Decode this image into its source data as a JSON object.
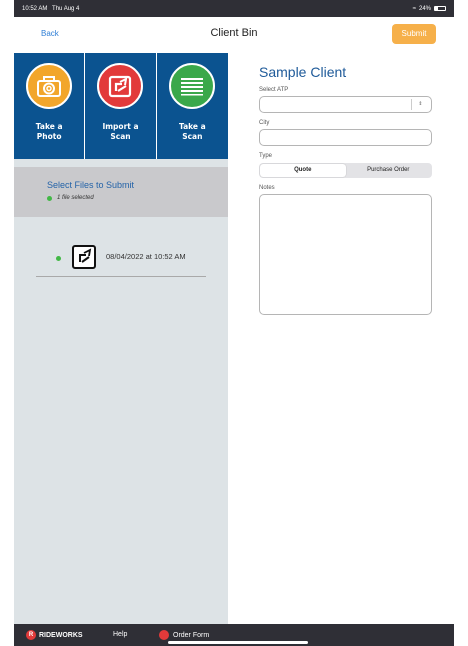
{
  "status": {
    "time": "10:52 AM",
    "date": "Thu Aug 4",
    "battery": "24%"
  },
  "nav": {
    "back_label": "Back",
    "title": "Client Bin",
    "submit_label": "Submit"
  },
  "tiles": [
    {
      "label": "Take a\nPhoto",
      "icon": "camera-icon",
      "color": "#f2a62b"
    },
    {
      "label": "Import a\nScan",
      "icon": "import-scan-icon",
      "color": "#e23a3a"
    },
    {
      "label": "Take a\nScan",
      "icon": "scan-lines-icon",
      "color": "#3aa84a"
    }
  ],
  "selection": {
    "title": "Select Files to Submit",
    "count_text": "1 file selected"
  },
  "files": [
    {
      "timestamp": "08/04/2022 at 10:52 AM",
      "icon": "import-scan-icon"
    }
  ],
  "client": {
    "name": "Sample Client",
    "select_atp_label": "Select ATP",
    "select_atp_value": "",
    "city_label": "City",
    "city_value": "",
    "type_label": "Type",
    "type_options": [
      "Quote",
      "Purchase Order"
    ],
    "type_selected": "Quote",
    "notes_label": "Notes",
    "notes_value": ""
  },
  "bottom_bar": {
    "brand": "RIDEWORKS",
    "help_label": "Help",
    "order_form_label": "Order Form"
  },
  "colors": {
    "accent_blue": "#0b5390",
    "submit_orange": "#f6b04a",
    "dot_green": "#42b846"
  }
}
